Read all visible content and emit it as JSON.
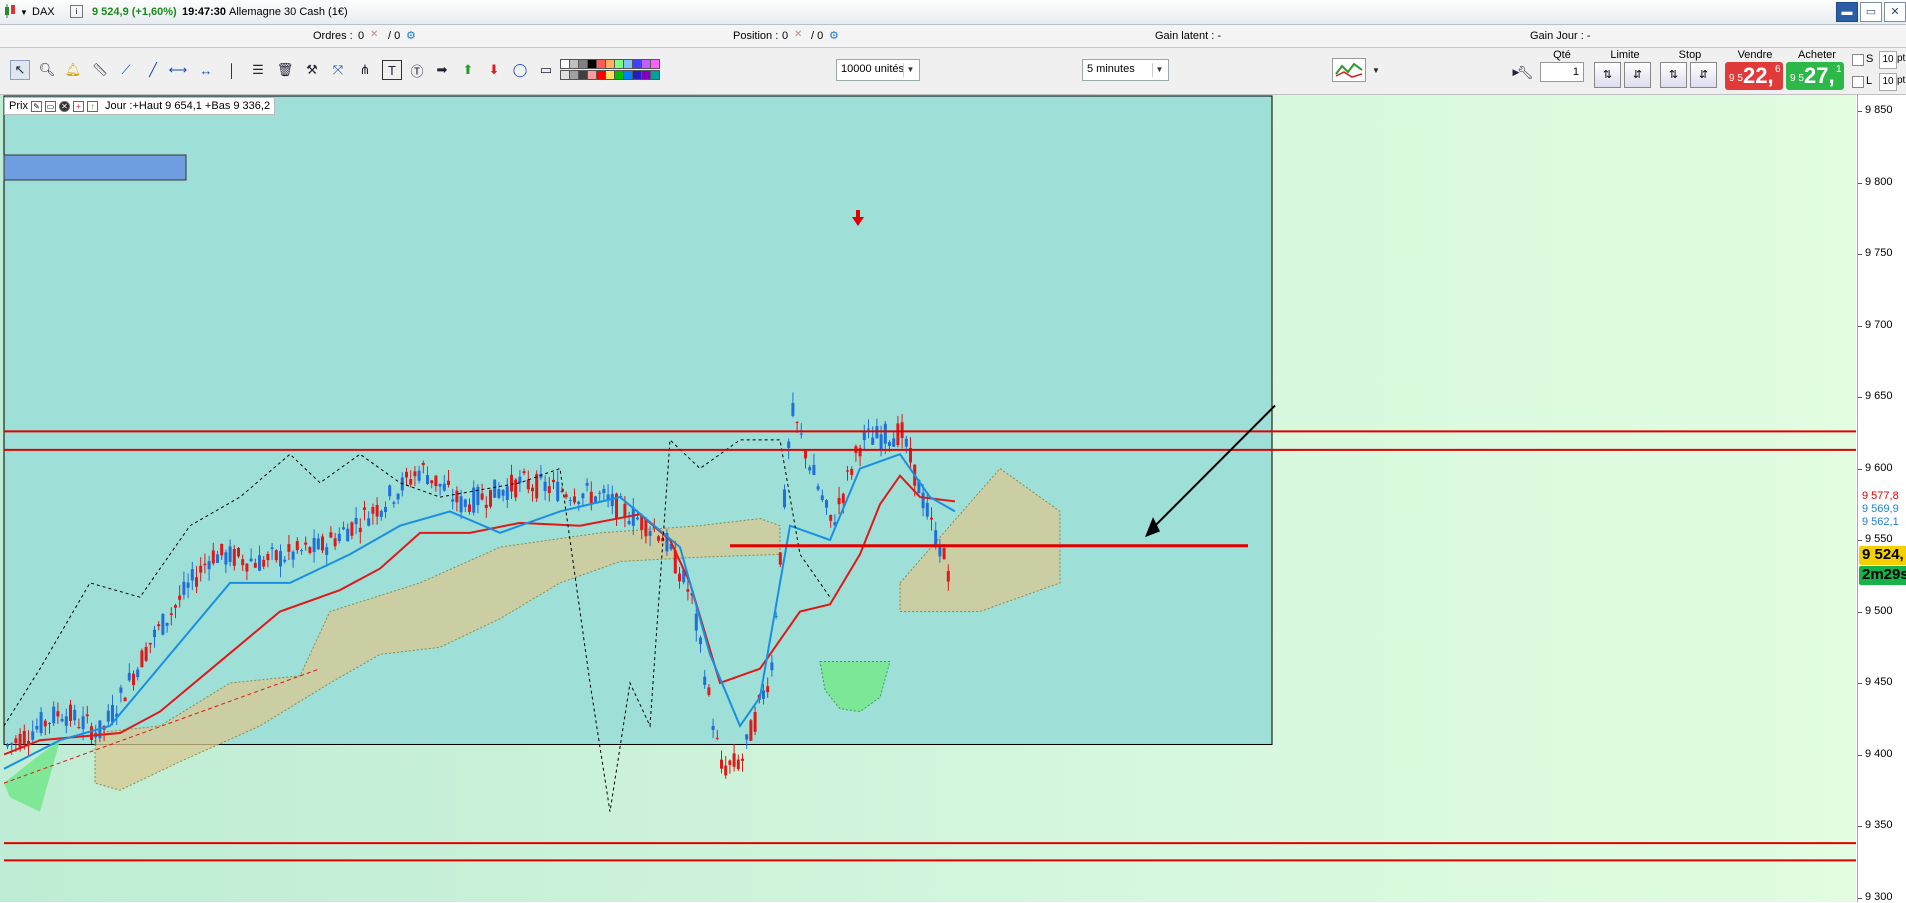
{
  "titlebar": {
    "instrument": "DAX",
    "quote": "9 524,9 (+1,60%)",
    "time": "19:47:30",
    "name": "Allemagne 30 Cash (1€)",
    "controls": [
      "▬",
      "▭",
      "✕"
    ]
  },
  "infobar": {
    "orders_label": "Ordres :",
    "orders_value": "0",
    "orders_slash": "/ 0",
    "position_label": "Position :",
    "position_value": "0",
    "position_slash": "/ 0",
    "gain_latent": "Gain latent : -",
    "gain_jour": "Gain Jour : -"
  },
  "toolbar": {
    "units_select": "10000 unités",
    "period_select": "5 minutes",
    "swatch_colors": [
      "#ffffff",
      "#e0e0e0",
      "#c0c0c0",
      "#a0a0a0",
      "#808080",
      "#404040",
      "#000000",
      "#ff9a9a",
      "#ff5a5a",
      "#ff0000",
      "#ffb060",
      "#ffe060",
      "#80ff80",
      "#00c000",
      "#80c0ff",
      "#0080ff",
      "#4040ff",
      "#2020c0",
      "#c060ff",
      "#8000c0",
      "#ff60ff",
      "#00a0a0"
    ]
  },
  "trade": {
    "qty_label": "Qté",
    "qty_value": "1",
    "limit_label": "Limite",
    "stop_label": "Stop",
    "sell_label": "Vendre",
    "buy_label": "Acheter",
    "sell_small": "9 5",
    "sell_big": "22,",
    "sell_sup": "6",
    "buy_small": "9 5",
    "buy_big": "27,",
    "buy_sup": "1",
    "s_label": "S",
    "l_label": "L",
    "s_value": "10",
    "l_value": "10",
    "pt_label": "pt"
  },
  "chart": {
    "header_label": "Prix",
    "header_text": "Jour :+Haut 9 654,1 +Bas 9 336,2",
    "yaxis_ticks": [
      "9 850",
      "9 800",
      "9 750",
      "9 700",
      "9 650",
      "9 600",
      "9 550",
      "9 500",
      "9 450",
      "9 400",
      "9 350",
      "9 300"
    ],
    "price_tags": [
      {
        "label": "9 577,8",
        "bg": "#ffffff",
        "fg": "#e00000"
      },
      {
        "label": "9 569,9",
        "bg": "#ffffff",
        "fg": "#1e7fd8"
      },
      {
        "label": "9 562,1",
        "bg": "#ffffff",
        "fg": "#1e7fd8"
      },
      {
        "label": "9 524,",
        "bg": "#f5d000",
        "fg": "#000000"
      },
      {
        "label": "2m29s",
        "bg": "#17b34a",
        "fg": "#000000"
      }
    ],
    "colors": {
      "zone": "#9edfd8",
      "candle_up": "#1e6fd8",
      "candle_down": "#e01818",
      "kijun": "#e01818",
      "tenkan": "#1a8fe0",
      "cloud_bull": "#d8c890",
      "cloud_bear": "#78e890",
      "rect": "#6e9ee0"
    }
  }
}
